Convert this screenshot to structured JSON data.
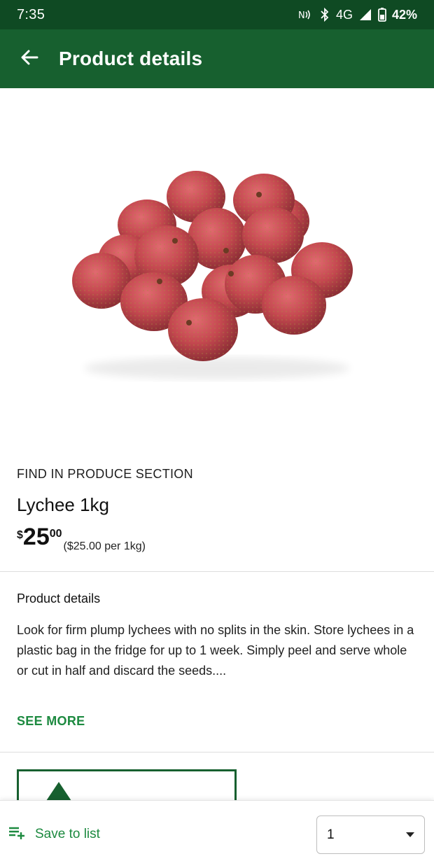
{
  "status_bar": {
    "time": "7:35",
    "network": "4G",
    "battery": "42%",
    "icons": [
      "nfc-icon",
      "bluetooth-icon",
      "signal-icon",
      "battery-icon"
    ]
  },
  "app_bar": {
    "title": "Product details",
    "back_icon": "arrow-left-icon"
  },
  "product": {
    "image": "lychee-pile",
    "section": "FIND IN PRODUCE SECTION",
    "name": "Lychee 1kg",
    "price_dollar_sign": "$",
    "price_whole": "25",
    "price_cents": "00",
    "unit_price": "($25.00 per 1kg)"
  },
  "details": {
    "heading": "Product details",
    "text": "Look for firm plump lychees with no splits in the skin. Store lychees in a plastic bag in the fridge for up to 1 week. Simply peel and serve whole or cut in half and discard the seeds....",
    "see_more": "SEE MORE"
  },
  "bottom_bar": {
    "save_label": "Save to list",
    "save_icon": "playlist-add-icon",
    "quantity": "1"
  },
  "colors": {
    "status_bar": "#0f4a23",
    "app_bar": "#17602f",
    "accent_green": "#1d8a40"
  }
}
